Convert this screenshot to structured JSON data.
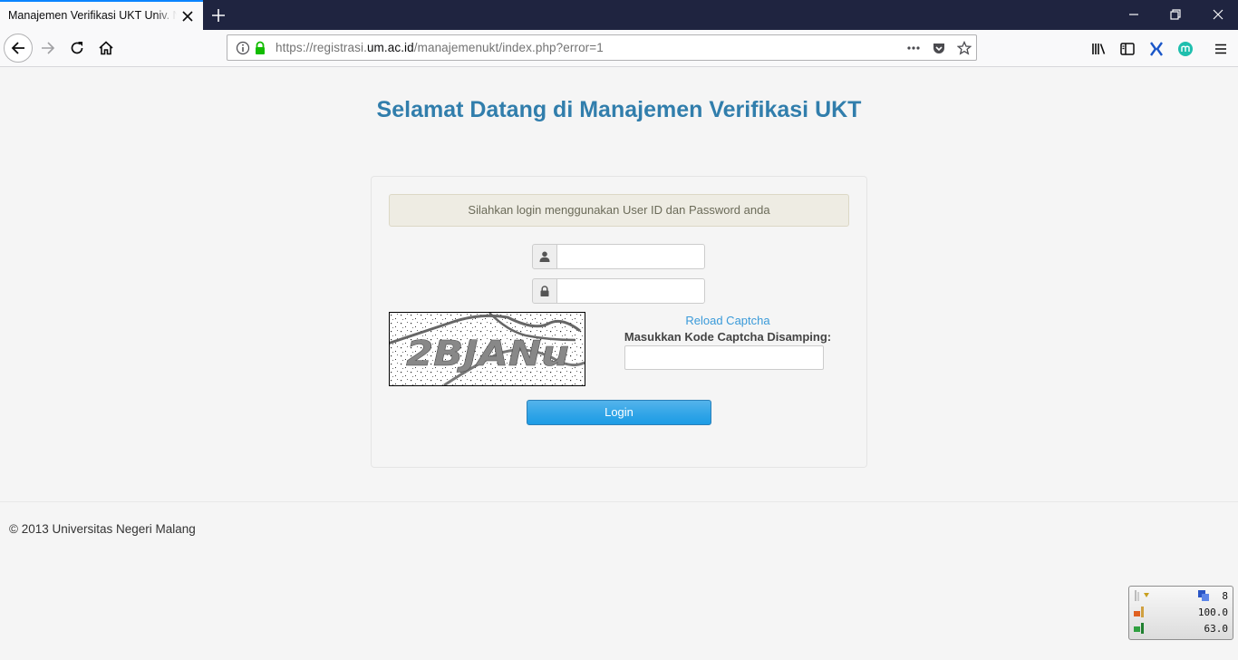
{
  "browser": {
    "tab_title": "Manajemen Verifikasi UKT Univ. Negeri Malang",
    "url_prefix": "https://registrasi.",
    "url_domain": "um.ac.id",
    "url_path": "/manajemenukt/index.php?error=1"
  },
  "page": {
    "title": "Selamat Datang di Manajemen Verifikasi UKT",
    "alert": "Silahkan login menggunakan User ID dan Password anda",
    "reload_captcha": "Reload Captcha",
    "captcha_label": "Masukkan Kode Captcha Disamping:",
    "captcha_code": "2BJANu",
    "username_value": "",
    "password_value": "",
    "captcha_value": "",
    "login_button": "Login"
  },
  "footer": {
    "text": "© 2013 Universitas Negeri Malang"
  },
  "system_monitor": {
    "values": [
      "8",
      "100.0",
      "63.0"
    ]
  },
  "colors": {
    "title": "#317eac",
    "accent_tab": "#0a84ff",
    "login_button": "#2fa4e7",
    "link": "#3a9ad9"
  }
}
